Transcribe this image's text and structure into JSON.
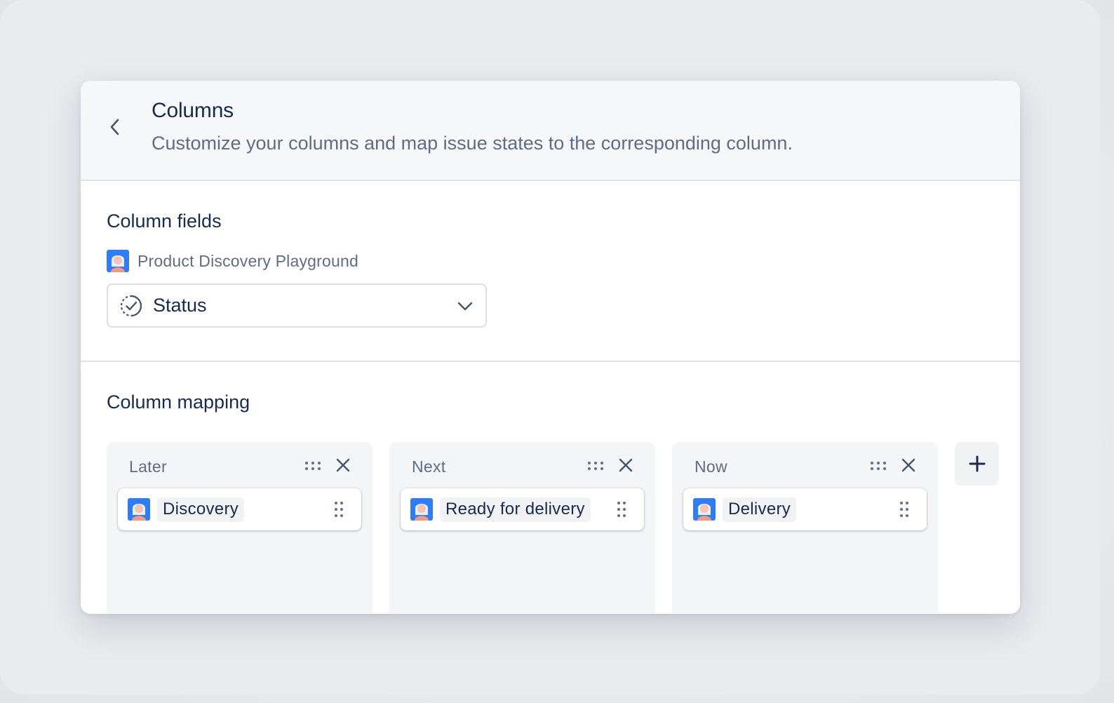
{
  "header": {
    "title": "Columns",
    "subtitle": "Customize your columns and map issue states to the corresponding column."
  },
  "column_fields": {
    "heading": "Column fields",
    "project_name": "Product Discovery Playground",
    "field_select": {
      "value": "Status"
    }
  },
  "column_mapping": {
    "heading": "Column mapping",
    "columns": [
      {
        "title": "Later",
        "states": [
          "Discovery"
        ]
      },
      {
        "title": "Next",
        "states": [
          "Ready for delivery"
        ]
      },
      {
        "title": "Now",
        "states": [
          "Delivery"
        ]
      }
    ]
  },
  "icons": {
    "back": "chevron-left-icon",
    "status": "status-check-icon",
    "dropdown": "chevron-down-icon",
    "drag": "drag-handle-icon",
    "close": "close-icon",
    "add": "plus-icon",
    "project": "project-avatar-icon"
  },
  "colors": {
    "text_primary": "#172b4d",
    "text_secondary": "#5e6c84",
    "header_bg": "#f6f7f8",
    "column_bg": "#f4f5f7",
    "avatar_blue": "#2f7df6"
  }
}
